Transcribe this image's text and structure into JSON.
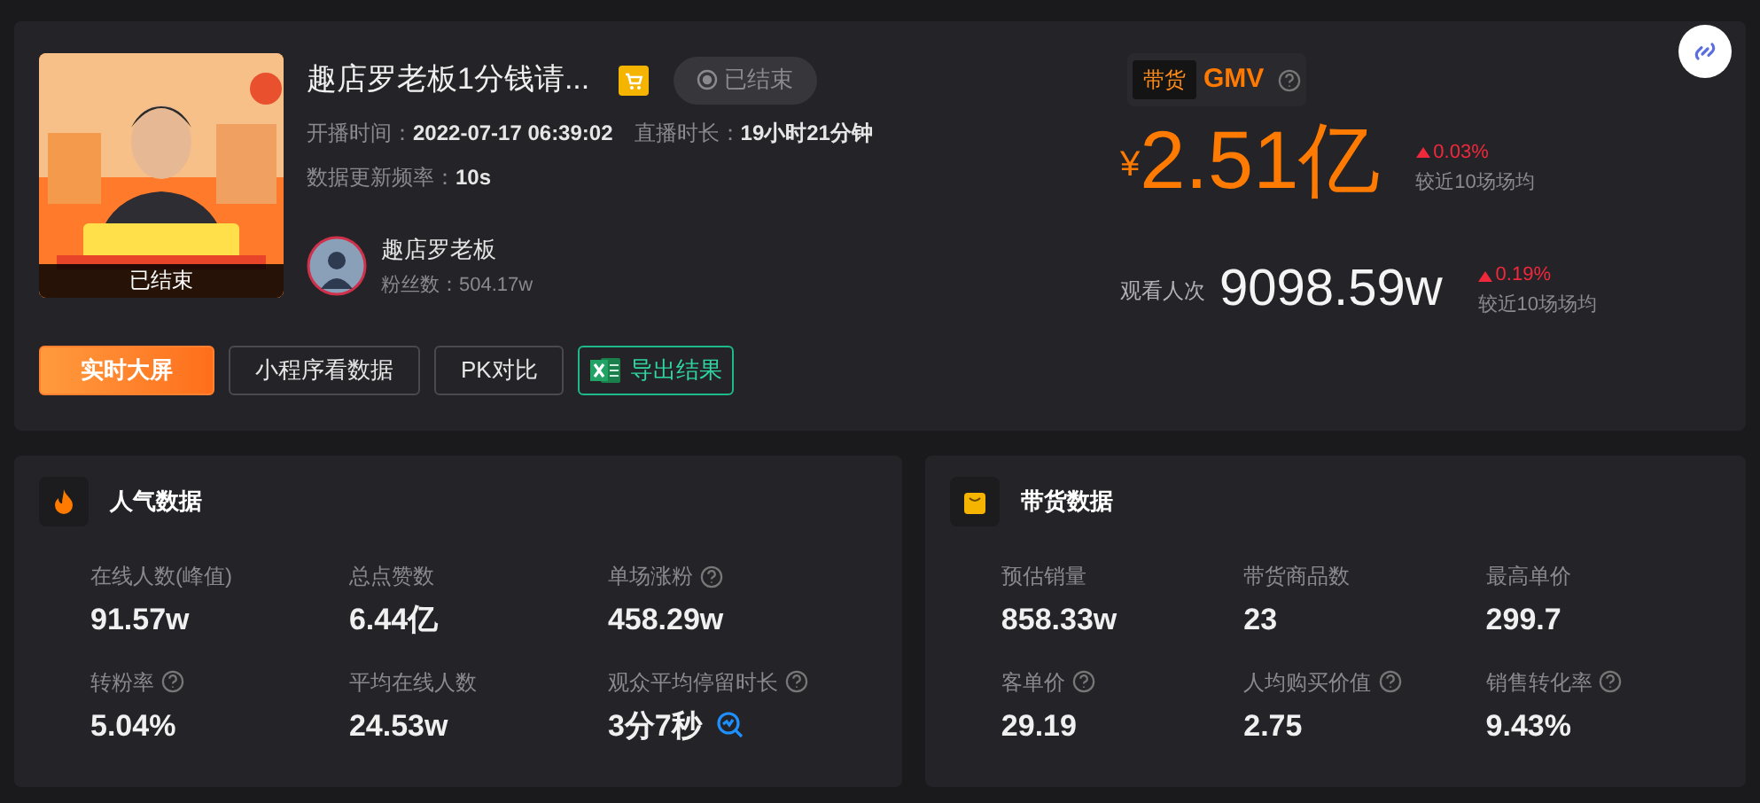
{
  "live": {
    "title": "趣店罗老板1分钱请...",
    "status": "已结束",
    "thumbnail_status": "已结束",
    "meta": [
      {
        "label": "开播时间：",
        "value": "2022-07-17 06:39:02"
      },
      {
        "label": "直播时长：",
        "value": "19小时21分钟"
      },
      {
        "label": "数据更新频率：",
        "value": "10s"
      }
    ],
    "author": {
      "name": "趣店罗老板",
      "fans_label": "粉丝数：",
      "fans": "504.17w"
    },
    "buttons": [
      {
        "label": "实时大屏",
        "kind": "primary"
      },
      {
        "label": "小程序看数据",
        "kind": "outline"
      },
      {
        "label": "PK对比",
        "kind": "outline"
      },
      {
        "label": "导出结果",
        "kind": "excel"
      }
    ]
  },
  "gmv": {
    "tag": "带货",
    "label": "GMV",
    "currency": "¥",
    "value": "2.51亿",
    "change": "0.03%",
    "compare": "较近10场场均"
  },
  "views": {
    "label": "观看人次",
    "value": "9098.59w",
    "change": "0.19%",
    "compare": "较近10场场均"
  },
  "panels": [
    {
      "title": "人气数据",
      "kind": "fire",
      "metrics": [
        {
          "label": "在线人数(峰值)",
          "value": "91.57w",
          "help": false,
          "kind": "plain"
        },
        {
          "label": "总点赞数",
          "value": "6.44亿",
          "help": false,
          "kind": "plain"
        },
        {
          "label": "单场涨粉",
          "value": "458.29w",
          "help": true,
          "kind": "plain"
        },
        {
          "label": "转粉率",
          "value": "5.04%",
          "help": true,
          "kind": "plain"
        },
        {
          "label": "平均在线人数",
          "value": "24.53w",
          "help": false,
          "kind": "plain"
        },
        {
          "label": "观众平均停留时长",
          "value": "3分7秒",
          "help": true,
          "kind": "chart_link"
        }
      ]
    },
    {
      "title": "带货数据",
      "kind": "bag",
      "metrics": [
        {
          "label": "预估销量",
          "value": "858.33w",
          "help": false,
          "kind": "plain"
        },
        {
          "label": "带货商品数",
          "value": "23",
          "help": false,
          "kind": "plain"
        },
        {
          "label": "最高单价",
          "value": "299.7",
          "help": false,
          "kind": "plain"
        },
        {
          "label": "客单价",
          "value": "29.19",
          "help": true,
          "kind": "plain"
        },
        {
          "label": "人均购买价值",
          "value": "2.75",
          "help": true,
          "kind": "plain"
        },
        {
          "label": "销售转化率",
          "value": "9.43%",
          "help": true,
          "kind": "plain"
        }
      ]
    }
  ]
}
